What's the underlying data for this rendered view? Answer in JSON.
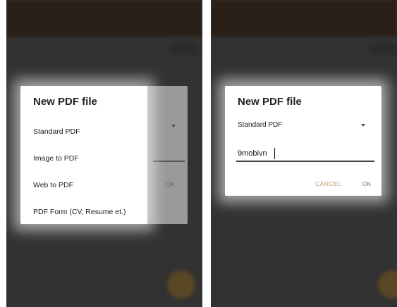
{
  "left_screen": {
    "dialog_title": "New PDF file",
    "type_menu": [
      "Standard PDF",
      "Image to PDF",
      "Web to PDF",
      "PDF Form (CV, Resume et.)"
    ],
    "underlying_ok_label": "OK"
  },
  "right_screen": {
    "dialog_title": "New PDF file",
    "pdf_type_selected": "Standard PDF",
    "file_name_value": "9mobivn",
    "cancel_label": "CANCEL",
    "ok_label": "OK"
  },
  "colors": {
    "app_background": "#323232",
    "accent": "#b8a070"
  }
}
